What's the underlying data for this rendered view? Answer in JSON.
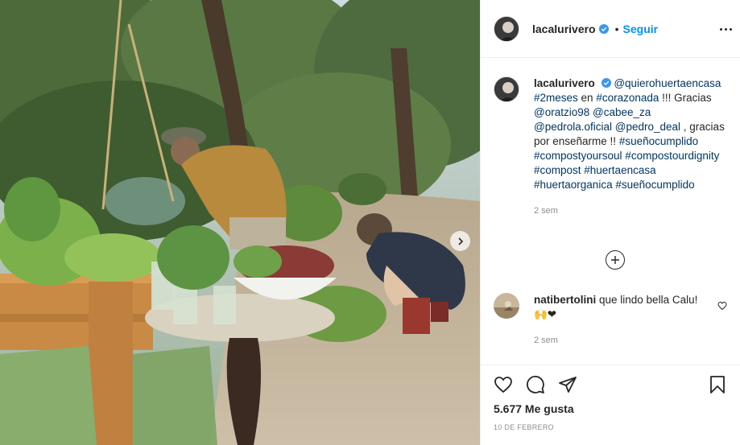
{
  "post": {
    "username": "lacalurivero",
    "follow_label": "Seguir",
    "dot": "•",
    "photo_icon": "next-arrow-icon"
  },
  "caption": {
    "username": "lacalurivero",
    "mention_1": "@quierohuertaencasa",
    "hashtag_1": "#2meses",
    "text_en": " en ",
    "hashtag_2": "#corazonada",
    "text_gracias": " !!! Gracias ",
    "mention_2": "@oratzio98",
    "mention_3": "@cabee_za",
    "mention_4": "@pedrola.oficial",
    "mention_5": "@pedro_deal",
    "text_end": " , gracias por enseñarme !!",
    "hashtags": "#sueñocumplido #compostyoursoul #compostourdignity #compost #huertaencasa #huertaorganica #sueñocumplido",
    "time": "2 sem"
  },
  "comment": {
    "username": "natibertolini",
    "text": " que lindo bella Calu!",
    "emoji": "🙌❤",
    "time": "2 sem"
  },
  "footer": {
    "likes": "5.677 Me gusta",
    "date": "10 DE FEBRERO"
  },
  "colors": {
    "link": "#0095f6",
    "tag": "#00376b",
    "muted": "#8e8e8e",
    "text": "#262626"
  }
}
